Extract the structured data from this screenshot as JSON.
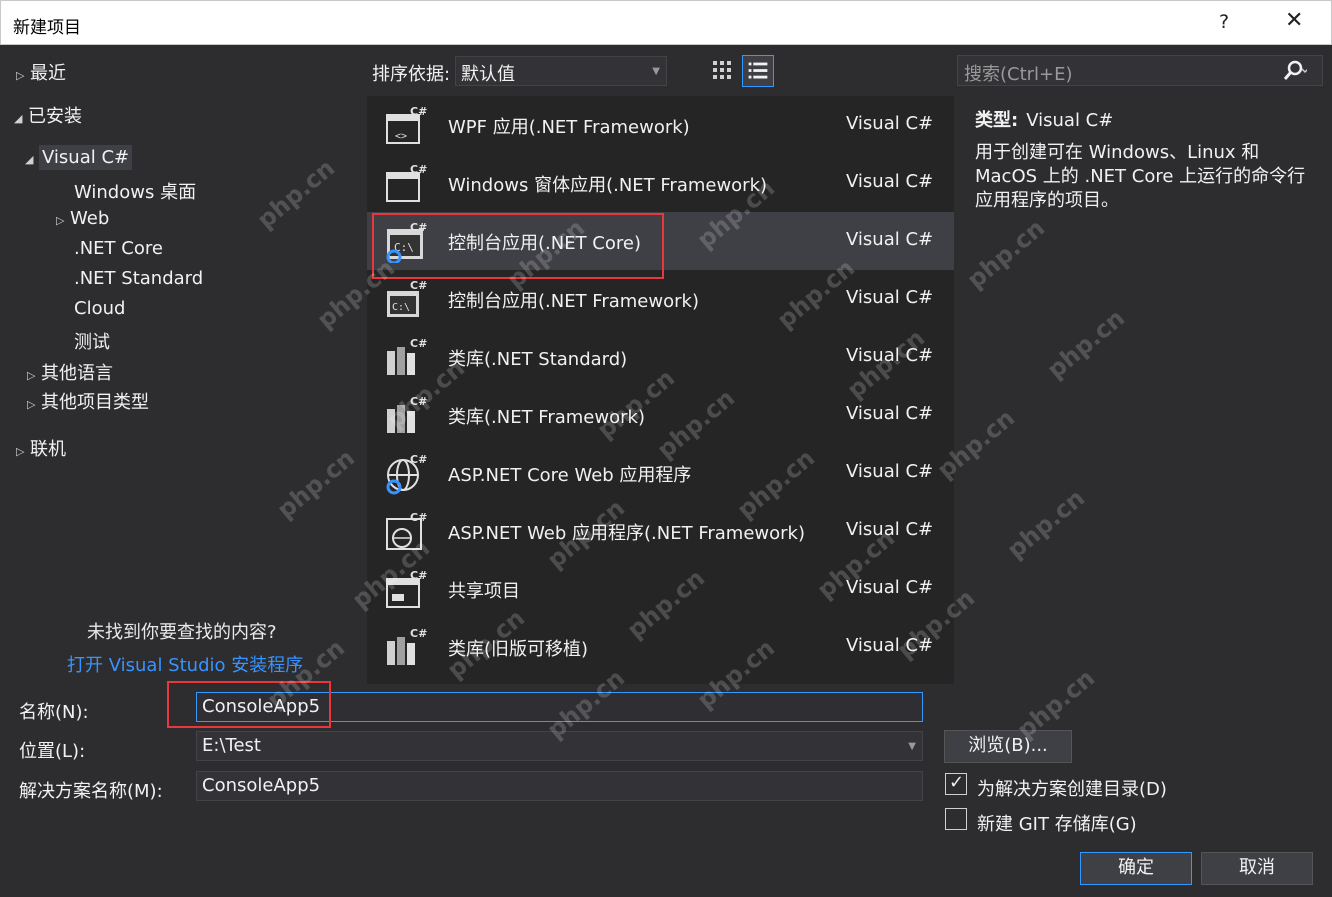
{
  "window": {
    "title": "新建项目",
    "help": "?",
    "close": "✕"
  },
  "tree": {
    "recent": "最近",
    "installed": "已安装",
    "visual_csharp": "Visual C#",
    "windows_desktop": "Windows 桌面",
    "web": "Web",
    "net_core": ".NET Core",
    "net_standard": ".NET Standard",
    "cloud": "Cloud",
    "test": "测试",
    "other_languages": "其他语言",
    "other_project_types": "其他项目类型",
    "online": "联机"
  },
  "not_found": {
    "text": "未找到你要查找的内容?",
    "link": "打开 Visual Studio 安装程序"
  },
  "sort": {
    "label": "排序依据:",
    "value": "默认值"
  },
  "search": {
    "placeholder": "搜索(Ctrl+E)"
  },
  "templates": [
    {
      "name": "WPF 应用(.NET Framework)",
      "lang": "Visual C#",
      "icon": "wpf-app-icon"
    },
    {
      "name": "Windows 窗体应用(.NET Framework)",
      "lang": "Visual C#",
      "icon": "winforms-app-icon"
    },
    {
      "name": "控制台应用(.NET Core)",
      "lang": "Visual C#",
      "icon": "console-core-icon",
      "selected": true
    },
    {
      "name": "控制台应用(.NET Framework)",
      "lang": "Visual C#",
      "icon": "console-framework-icon"
    },
    {
      "name": "类库(.NET Standard)",
      "lang": "Visual C#",
      "icon": "class-library-icon"
    },
    {
      "name": "类库(.NET Framework)",
      "lang": "Visual C#",
      "icon": "class-library-icon"
    },
    {
      "name": "ASP.NET Core Web 应用程序",
      "lang": "Visual C#",
      "icon": "aspnet-core-icon"
    },
    {
      "name": "ASP.NET Web 应用程序(.NET Framework)",
      "lang": "Visual C#",
      "icon": "aspnet-web-icon"
    },
    {
      "name": "共享项目",
      "lang": "Visual C#",
      "icon": "shared-project-icon"
    },
    {
      "name": "类库(旧版可移植)",
      "lang": "Visual C#",
      "icon": "portable-library-icon"
    }
  ],
  "description": {
    "type_label": "类型:",
    "type_value": "Visual C#",
    "text": "用于创建可在 Windows、Linux 和 MacOS 上的 .NET Core 上运行的命令行应用程序的项目。"
  },
  "form": {
    "name_label": "名称(N):",
    "name_value": "ConsoleApp5",
    "location_label": "位置(L):",
    "location_value": "E:\\Test",
    "solution_label": "解决方案名称(M):",
    "solution_value": "ConsoleApp5",
    "browse": "浏览(B)...",
    "create_dir_label": "为解决方案创建目录(D)",
    "create_dir_checked": true,
    "git_label": "新建 GIT 存储库(G)",
    "git_checked": false,
    "ok": "确定",
    "cancel": "取消"
  },
  "watermark_text": "php.cn",
  "colors": {
    "accent": "#3399ff",
    "highlight_box": "#e8383d",
    "link": "#3794ff",
    "background": "#2d2d30"
  }
}
